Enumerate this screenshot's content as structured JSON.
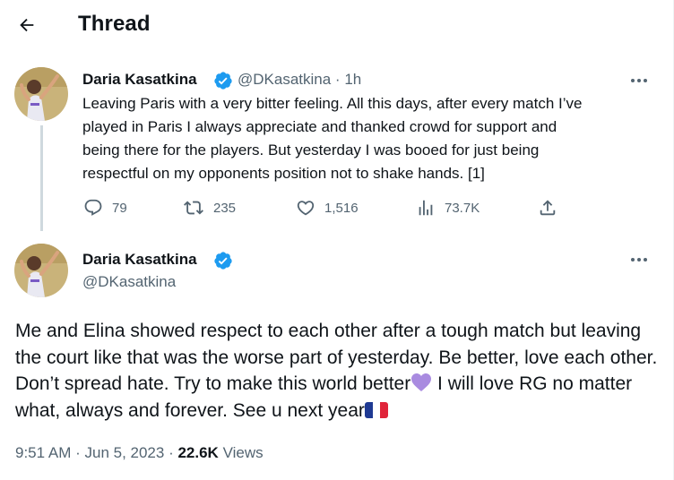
{
  "header": {
    "title": "Thread"
  },
  "tweet1": {
    "name": "Daria Kasatkina",
    "handle": "@DKasatkina",
    "time": "1h",
    "text": "Leaving Paris with a very bitter feeling. All this days, after every match I’ve\nplayed  in Paris I always appreciate and thanked crowd for support and\nbeing there for the players. But yesterday I was booed for just being\nrespectful on my opponents position not to shake hands. [1]",
    "replies": "79",
    "retweets": "235",
    "likes": "1,516",
    "views": "73.7K"
  },
  "tweet2": {
    "name": "Daria Kasatkina",
    "handle": "@DKasatkina",
    "text_part1": "Me and Elina showed respect to each other after a tough match but leaving the court like that was the worse part of yesterday. Be better, love each other. Don’t spread hate. Try to make this world better",
    "text_part2": " I will love RG no matter what, always and forever. See u next year",
    "time": "9:51 AM",
    "date": "Jun 5, 2023",
    "views_count": "22.6K",
    "views_label": "Views"
  },
  "colors": {
    "verified": "#1d9bf0",
    "secondary": "#536471",
    "text": "#0f1419",
    "heart_emoji": "#a98be0"
  }
}
